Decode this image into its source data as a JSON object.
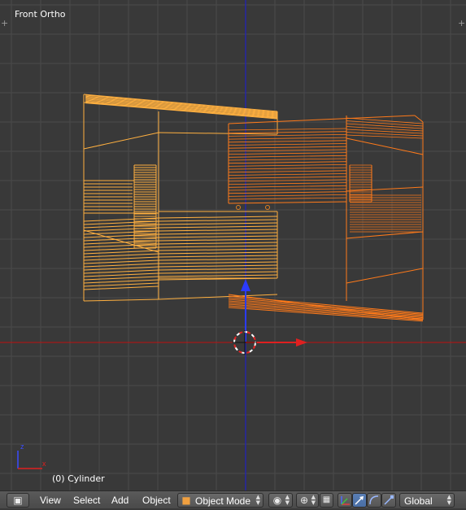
{
  "viewport": {
    "view_name": "Front Ortho",
    "object_info": "(0) Cylinder",
    "colors": {
      "background": "#393939",
      "grid": "#4a4a4a",
      "z_axis": "#2020c0",
      "x_axis": "#c01010",
      "selected_wire": "#ff7a1a",
      "unselected_wire": "#ffb040"
    }
  },
  "header": {
    "menu": [
      "View",
      "Select",
      "Add",
      "Object"
    ],
    "mode_label": "Object Mode",
    "orientation_label": "Global"
  },
  "icons": {
    "editor_type": "cube-icon",
    "viewport_shading": "sphere-icon",
    "pivot_point": "pivot-icon",
    "snap": "snap-icon",
    "manipulator": "axes-icon",
    "translate": "arrow-icon",
    "rotate": "arc-icon",
    "scale": "scale-icon"
  }
}
